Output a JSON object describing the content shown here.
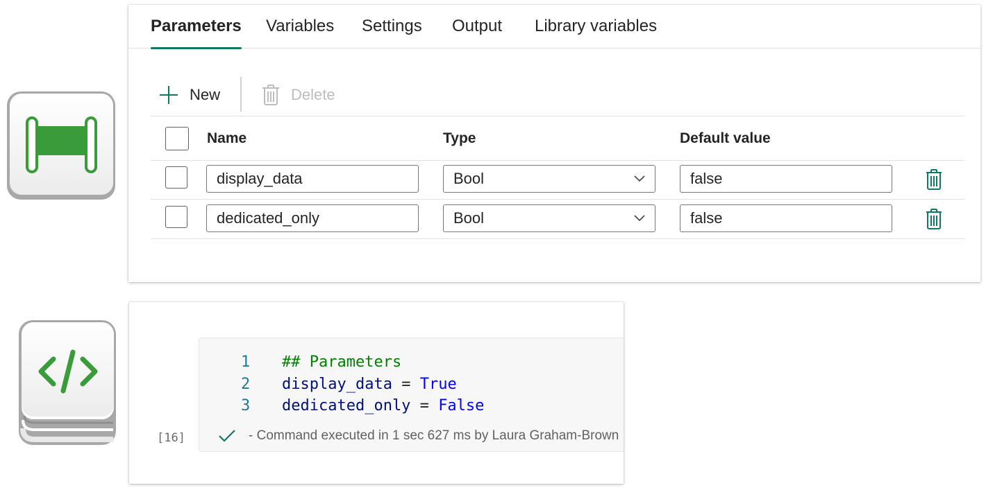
{
  "tabs": [
    {
      "label": "Parameters",
      "active": true
    },
    {
      "label": "Variables",
      "active": false
    },
    {
      "label": "Settings",
      "active": false
    },
    {
      "label": "Output",
      "active": false
    },
    {
      "label": "Library variables",
      "active": false
    }
  ],
  "toolbar": {
    "new_label": "New",
    "delete_label": "Delete",
    "new_icon": "plus-icon",
    "delete_icon": "trash-icon"
  },
  "grid": {
    "headers": {
      "name": "Name",
      "type": "Type",
      "default": "Default value"
    },
    "rows": [
      {
        "name": "display_data",
        "type": "Bool",
        "default": "false"
      },
      {
        "name": "dedicated_only",
        "type": "Bool",
        "default": "false"
      }
    ]
  },
  "notebook": {
    "lines": [
      {
        "num": "1",
        "comment": "## Parameters"
      },
      {
        "num": "2",
        "var": "display_data",
        "op": " = ",
        "val": "True"
      },
      {
        "num": "3",
        "var": "dedicated_only",
        "op": " = ",
        "val": "False"
      }
    ],
    "exec_count": "[16]",
    "status": "- Command executed in 1 sec 627 ms by Laura Graham-Brown"
  },
  "colors": {
    "accent": "#117865",
    "pipeline_green": "#3a9b3a",
    "comment": "#008000",
    "keyword": "#0000ff",
    "variable": "#001080",
    "line_number": "#237893"
  },
  "icons": {
    "pipeline": "pipeline-activity-icon",
    "notebook": "notebook-code-icon",
    "row_delete": "trash-icon",
    "status": "checkmark-icon",
    "dropdown": "chevron-down-icon"
  }
}
